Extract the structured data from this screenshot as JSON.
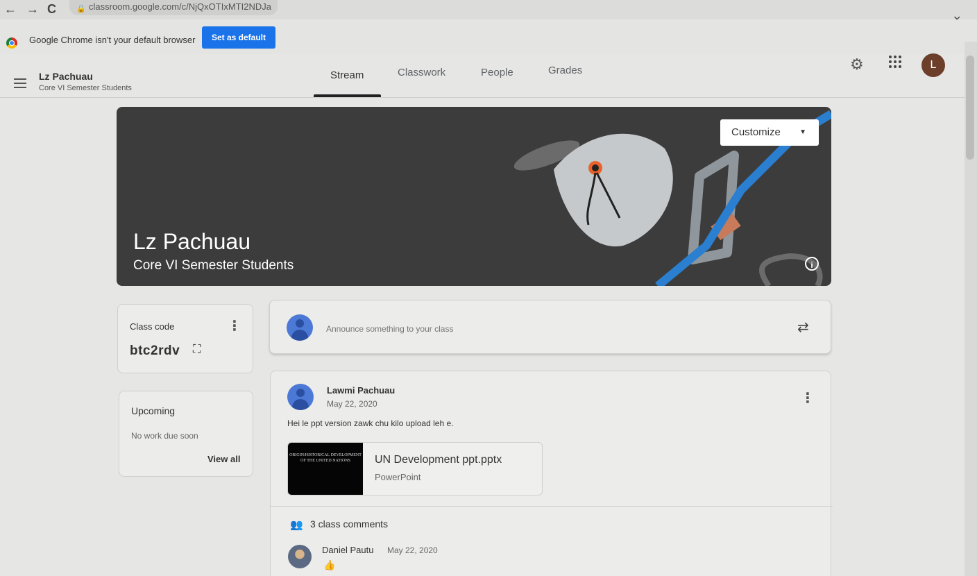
{
  "browser": {
    "url": "classroom.google.com/c/NjQxOTIxMTI2NDJa",
    "infobar_text": "Google Chrome isn't your default browser",
    "set_default_label": "Set as default",
    "close_glyph": "×",
    "back_glyph": "←",
    "forward_glyph": "→",
    "reload_glyph": "C"
  },
  "header": {
    "course_name": "Lz Pachuau",
    "course_section": "Core VI Semester Students",
    "tabs": [
      {
        "label": "Stream",
        "active": true
      },
      {
        "label": "Classwork",
        "active": false
      },
      {
        "label": "People",
        "active": false
      },
      {
        "label": "Grades",
        "active": false
      }
    ],
    "avatar_letter": "L"
  },
  "banner": {
    "title": "Lz Pachuau",
    "subtitle": "Core VI Semester Students",
    "customize_label": "Customize",
    "info_glyph": "i"
  },
  "class_code": {
    "label": "Class code",
    "value": "btc2rdv"
  },
  "upcoming": {
    "title": "Upcoming",
    "empty_text": "No work due soon",
    "view_all_label": "View all"
  },
  "announce": {
    "placeholder": "Announce something to your class"
  },
  "post": {
    "author": "Lawmi Pachuau",
    "date": "May 22, 2020",
    "body": "Hei le ppt version zawk chu kilo upload leh e.",
    "attachment": {
      "thumb_text": "ORIGIN/HISTORICAL DEVELOPMENT OF THE UNITED NATIONS",
      "name": "UN Development ppt.pptx",
      "type": "PowerPoint"
    },
    "comments_count_label": "3 class comments",
    "comment": {
      "author": "Daniel Pautu",
      "date": "May 22, 2020",
      "text": "👍"
    }
  },
  "icons": {
    "settings": "gear-icon",
    "apps": "apps-grid-icon",
    "hamburger": "menu-icon",
    "repost": "repost-icon",
    "more": "more-vert-icon"
  },
  "colors": {
    "accent_blue": "#1a73e8",
    "banner_bg": "#3c3c3c",
    "avatar_brown": "#6b3f2a"
  }
}
